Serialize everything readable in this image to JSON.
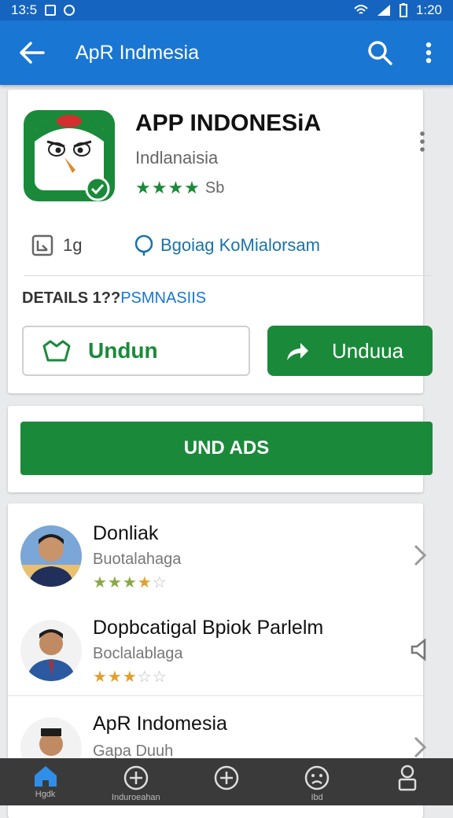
{
  "status_bar": {
    "time_left": "13:5",
    "time_right": "1:20"
  },
  "app_bar": {
    "title": "ApR Indmesia",
    "back_icon": "arrow-back-icon",
    "search_icon": "search-icon",
    "more_icon": "more-vert-icon"
  },
  "app_card": {
    "title": "APP INDONESiA",
    "subtitle": "Indlanaisia",
    "stars": "★★★★",
    "rating_text": "Sb",
    "size_text": "1g",
    "link_text": "Bgoiag KoMialorsam",
    "details_label": "DETAILS 1??",
    "details_link": "PSMNASIIS",
    "outline_button_label": "Undun",
    "fill_button_label": "Unduua"
  },
  "primary_action": {
    "label": "UND ADS"
  },
  "list": [
    {
      "name": "Donliak",
      "subtitle": "Buotalahaga",
      "stars_on": "★★★",
      "stars_half": "★",
      "stars_off": "☆"
    },
    {
      "name": "Dopbcatigal Bpiok Parlelm",
      "subtitle": "Boclalablaga",
      "stars_on": "★★★",
      "stars_half": "",
      "stars_off": "☆☆"
    },
    {
      "name": "ApR Indomesia",
      "subtitle": "Gapa Duuh"
    }
  ],
  "nav": [
    {
      "label": "Hgdk",
      "icon": "home-icon"
    },
    {
      "label": "Induroeahan",
      "icon": "plus-circle-icon"
    },
    {
      "label": "",
      "icon": "plus-circle-icon"
    },
    {
      "label": "Ibd",
      "icon": "sad-face-icon"
    },
    {
      "label": "",
      "icon": "profile-icon"
    }
  ],
  "colors": {
    "app_bar": "#1976d2",
    "status_bar": "#1565c0",
    "accent_green": "#1a8a3a",
    "link_blue": "#1a73a8"
  }
}
